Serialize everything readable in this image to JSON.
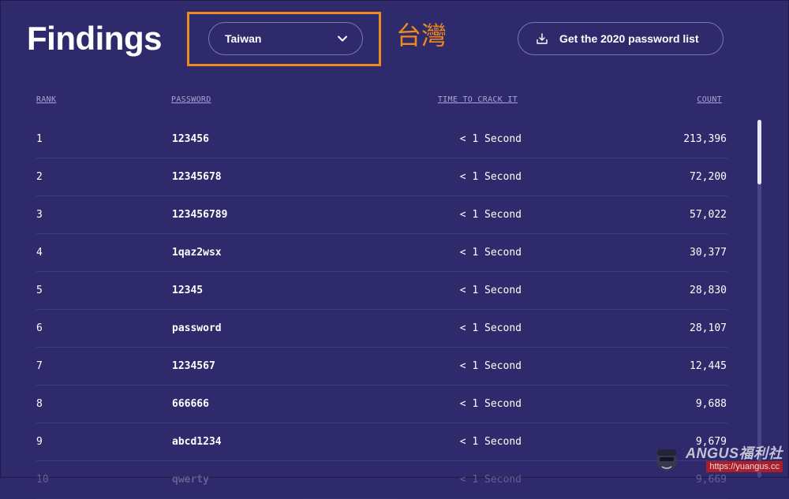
{
  "header": {
    "title": "Findings",
    "country_select": {
      "value": "Taiwan"
    },
    "annotation": "台灣",
    "download_button": {
      "label": "Get the 2020 password list"
    }
  },
  "table": {
    "columns": {
      "rank": "RANK",
      "password": "PASSWORD",
      "time_to_crack": "TIME TO CRACK IT",
      "count": "COUNT"
    },
    "rows": [
      {
        "rank": "1",
        "password": "123456",
        "time": "< 1 Second",
        "count": "213,396"
      },
      {
        "rank": "2",
        "password": "12345678",
        "time": "< 1 Second",
        "count": "72,200"
      },
      {
        "rank": "3",
        "password": "123456789",
        "time": "< 1 Second",
        "count": "57,022"
      },
      {
        "rank": "4",
        "password": "1qaz2wsx",
        "time": "< 1 Second",
        "count": "30,377"
      },
      {
        "rank": "5",
        "password": "12345",
        "time": "< 1 Second",
        "count": "28,830"
      },
      {
        "rank": "6",
        "password": "password",
        "time": "< 1 Second",
        "count": "28,107"
      },
      {
        "rank": "7",
        "password": "1234567",
        "time": "< 1 Second",
        "count": "12,445"
      },
      {
        "rank": "8",
        "password": "666666",
        "time": "< 1 Second",
        "count": "9,688"
      },
      {
        "rank": "9",
        "password": "abcd1234",
        "time": "< 1 Second",
        "count": "9,679"
      },
      {
        "rank": "10",
        "password": "qwerty",
        "time": "< 1 Second",
        "count": "9,669"
      }
    ]
  },
  "watermark": {
    "brand": "ANGUS福利社",
    "url": "https://yuangus.cc"
  },
  "colors": {
    "background": "#2f2a6b",
    "accent_orange": "#f08a1c",
    "text": "#ffffff",
    "header_text": "#a9a6d6"
  },
  "icons": {
    "dropdown": "chevron-down-icon",
    "download": "download-icon"
  }
}
